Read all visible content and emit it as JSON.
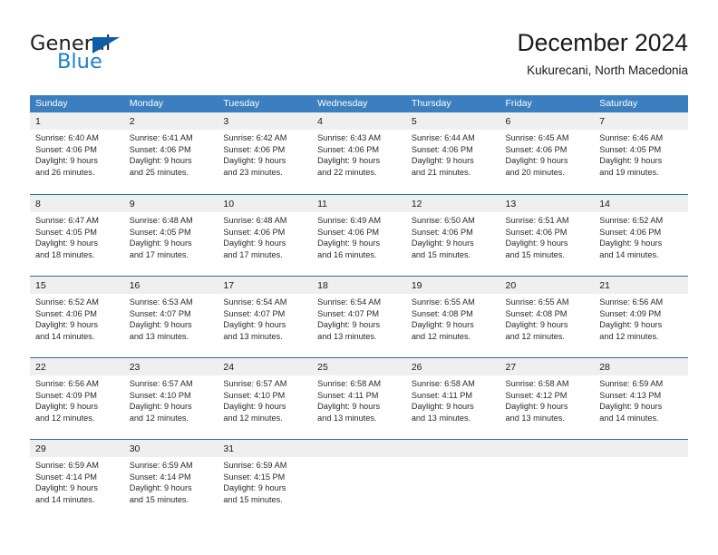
{
  "brand": {
    "name_part1": "General",
    "name_part2": "Blue",
    "flag_icon": "triangle-flag-icon",
    "accent_color": "#0d5ea8",
    "blue_text_color": "#1f7fc4"
  },
  "header": {
    "title": "December 2024",
    "subtitle": "Kukurecani, North Macedonia"
  },
  "calendar": {
    "header_bg": "#3c7fc0",
    "day_band_bg": "#efefef",
    "row_divider_color": "#1f6eb5",
    "weekdays": [
      "Sunday",
      "Monday",
      "Tuesday",
      "Wednesday",
      "Thursday",
      "Friday",
      "Saturday"
    ],
    "weeks": [
      [
        {
          "day": "1",
          "sunrise": "Sunrise: 6:40 AM",
          "sunset": "Sunset: 4:06 PM",
          "daylight1": "Daylight: 9 hours",
          "daylight2": "and 26 minutes."
        },
        {
          "day": "2",
          "sunrise": "Sunrise: 6:41 AM",
          "sunset": "Sunset: 4:06 PM",
          "daylight1": "Daylight: 9 hours",
          "daylight2": "and 25 minutes."
        },
        {
          "day": "3",
          "sunrise": "Sunrise: 6:42 AM",
          "sunset": "Sunset: 4:06 PM",
          "daylight1": "Daylight: 9 hours",
          "daylight2": "and 23 minutes."
        },
        {
          "day": "4",
          "sunrise": "Sunrise: 6:43 AM",
          "sunset": "Sunset: 4:06 PM",
          "daylight1": "Daylight: 9 hours",
          "daylight2": "and 22 minutes."
        },
        {
          "day": "5",
          "sunrise": "Sunrise: 6:44 AM",
          "sunset": "Sunset: 4:06 PM",
          "daylight1": "Daylight: 9 hours",
          "daylight2": "and 21 minutes."
        },
        {
          "day": "6",
          "sunrise": "Sunrise: 6:45 AM",
          "sunset": "Sunset: 4:06 PM",
          "daylight1": "Daylight: 9 hours",
          "daylight2": "and 20 minutes."
        },
        {
          "day": "7",
          "sunrise": "Sunrise: 6:46 AM",
          "sunset": "Sunset: 4:05 PM",
          "daylight1": "Daylight: 9 hours",
          "daylight2": "and 19 minutes."
        }
      ],
      [
        {
          "day": "8",
          "sunrise": "Sunrise: 6:47 AM",
          "sunset": "Sunset: 4:05 PM",
          "daylight1": "Daylight: 9 hours",
          "daylight2": "and 18 minutes."
        },
        {
          "day": "9",
          "sunrise": "Sunrise: 6:48 AM",
          "sunset": "Sunset: 4:05 PM",
          "daylight1": "Daylight: 9 hours",
          "daylight2": "and 17 minutes."
        },
        {
          "day": "10",
          "sunrise": "Sunrise: 6:48 AM",
          "sunset": "Sunset: 4:06 PM",
          "daylight1": "Daylight: 9 hours",
          "daylight2": "and 17 minutes."
        },
        {
          "day": "11",
          "sunrise": "Sunrise: 6:49 AM",
          "sunset": "Sunset: 4:06 PM",
          "daylight1": "Daylight: 9 hours",
          "daylight2": "and 16 minutes."
        },
        {
          "day": "12",
          "sunrise": "Sunrise: 6:50 AM",
          "sunset": "Sunset: 4:06 PM",
          "daylight1": "Daylight: 9 hours",
          "daylight2": "and 15 minutes."
        },
        {
          "day": "13",
          "sunrise": "Sunrise: 6:51 AM",
          "sunset": "Sunset: 4:06 PM",
          "daylight1": "Daylight: 9 hours",
          "daylight2": "and 15 minutes."
        },
        {
          "day": "14",
          "sunrise": "Sunrise: 6:52 AM",
          "sunset": "Sunset: 4:06 PM",
          "daylight1": "Daylight: 9 hours",
          "daylight2": "and 14 minutes."
        }
      ],
      [
        {
          "day": "15",
          "sunrise": "Sunrise: 6:52 AM",
          "sunset": "Sunset: 4:06 PM",
          "daylight1": "Daylight: 9 hours",
          "daylight2": "and 14 minutes."
        },
        {
          "day": "16",
          "sunrise": "Sunrise: 6:53 AM",
          "sunset": "Sunset: 4:07 PM",
          "daylight1": "Daylight: 9 hours",
          "daylight2": "and 13 minutes."
        },
        {
          "day": "17",
          "sunrise": "Sunrise: 6:54 AM",
          "sunset": "Sunset: 4:07 PM",
          "daylight1": "Daylight: 9 hours",
          "daylight2": "and 13 minutes."
        },
        {
          "day": "18",
          "sunrise": "Sunrise: 6:54 AM",
          "sunset": "Sunset: 4:07 PM",
          "daylight1": "Daylight: 9 hours",
          "daylight2": "and 13 minutes."
        },
        {
          "day": "19",
          "sunrise": "Sunrise: 6:55 AM",
          "sunset": "Sunset: 4:08 PM",
          "daylight1": "Daylight: 9 hours",
          "daylight2": "and 12 minutes."
        },
        {
          "day": "20",
          "sunrise": "Sunrise: 6:55 AM",
          "sunset": "Sunset: 4:08 PM",
          "daylight1": "Daylight: 9 hours",
          "daylight2": "and 12 minutes."
        },
        {
          "day": "21",
          "sunrise": "Sunrise: 6:56 AM",
          "sunset": "Sunset: 4:09 PM",
          "daylight1": "Daylight: 9 hours",
          "daylight2": "and 12 minutes."
        }
      ],
      [
        {
          "day": "22",
          "sunrise": "Sunrise: 6:56 AM",
          "sunset": "Sunset: 4:09 PM",
          "daylight1": "Daylight: 9 hours",
          "daylight2": "and 12 minutes."
        },
        {
          "day": "23",
          "sunrise": "Sunrise: 6:57 AM",
          "sunset": "Sunset: 4:10 PM",
          "daylight1": "Daylight: 9 hours",
          "daylight2": "and 12 minutes."
        },
        {
          "day": "24",
          "sunrise": "Sunrise: 6:57 AM",
          "sunset": "Sunset: 4:10 PM",
          "daylight1": "Daylight: 9 hours",
          "daylight2": "and 12 minutes."
        },
        {
          "day": "25",
          "sunrise": "Sunrise: 6:58 AM",
          "sunset": "Sunset: 4:11 PM",
          "daylight1": "Daylight: 9 hours",
          "daylight2": "and 13 minutes."
        },
        {
          "day": "26",
          "sunrise": "Sunrise: 6:58 AM",
          "sunset": "Sunset: 4:11 PM",
          "daylight1": "Daylight: 9 hours",
          "daylight2": "and 13 minutes."
        },
        {
          "day": "27",
          "sunrise": "Sunrise: 6:58 AM",
          "sunset": "Sunset: 4:12 PM",
          "daylight1": "Daylight: 9 hours",
          "daylight2": "and 13 minutes."
        },
        {
          "day": "28",
          "sunrise": "Sunrise: 6:59 AM",
          "sunset": "Sunset: 4:13 PM",
          "daylight1": "Daylight: 9 hours",
          "daylight2": "and 14 minutes."
        }
      ],
      [
        {
          "day": "29",
          "sunrise": "Sunrise: 6:59 AM",
          "sunset": "Sunset: 4:14 PM",
          "daylight1": "Daylight: 9 hours",
          "daylight2": "and 14 minutes."
        },
        {
          "day": "30",
          "sunrise": "Sunrise: 6:59 AM",
          "sunset": "Sunset: 4:14 PM",
          "daylight1": "Daylight: 9 hours",
          "daylight2": "and 15 minutes."
        },
        {
          "day": "31",
          "sunrise": "Sunrise: 6:59 AM",
          "sunset": "Sunset: 4:15 PM",
          "daylight1": "Daylight: 9 hours",
          "daylight2": "and 15 minutes."
        },
        {
          "day": "",
          "sunrise": "",
          "sunset": "",
          "daylight1": "",
          "daylight2": ""
        },
        {
          "day": "",
          "sunrise": "",
          "sunset": "",
          "daylight1": "",
          "daylight2": ""
        },
        {
          "day": "",
          "sunrise": "",
          "sunset": "",
          "daylight1": "",
          "daylight2": ""
        },
        {
          "day": "",
          "sunrise": "",
          "sunset": "",
          "daylight1": "",
          "daylight2": ""
        }
      ]
    ]
  }
}
